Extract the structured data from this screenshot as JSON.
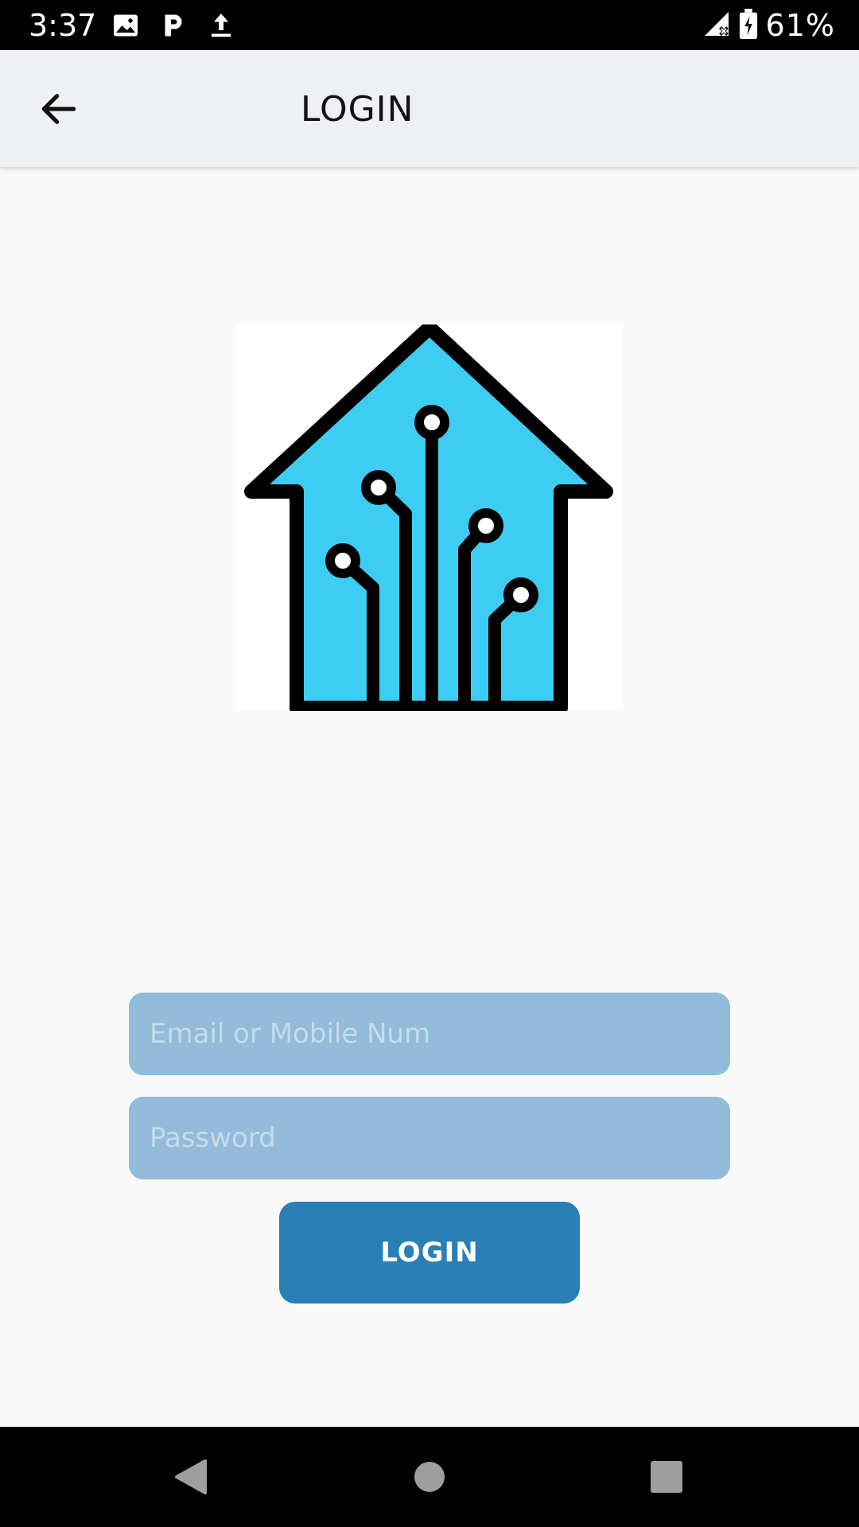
{
  "status_bar": {
    "time": "3:37",
    "battery_percent": "61%",
    "icons": [
      "image-icon",
      "p-icon",
      "upload-icon",
      "signal-off-icon",
      "battery-charging-icon"
    ]
  },
  "app_bar": {
    "title": "LOGIN",
    "back_icon": "arrow-left-icon"
  },
  "logo": {
    "icon": "smart-home-circuit-logo",
    "colors": {
      "fill": "#3ecdf2",
      "stroke": "#000000",
      "background": "#ffffff"
    }
  },
  "form": {
    "email_placeholder": "Email or Mobile Num",
    "email_value": "",
    "password_placeholder": "Password",
    "password_value": "",
    "login_label": "LOGIN"
  },
  "colors": {
    "input_background": "#92bcd9",
    "button_background": "#2a7fb7",
    "app_bar_background": "#eef0f3"
  },
  "nav_bar": {
    "buttons": [
      "back-triangle-icon",
      "home-circle-icon",
      "recents-square-icon"
    ]
  }
}
